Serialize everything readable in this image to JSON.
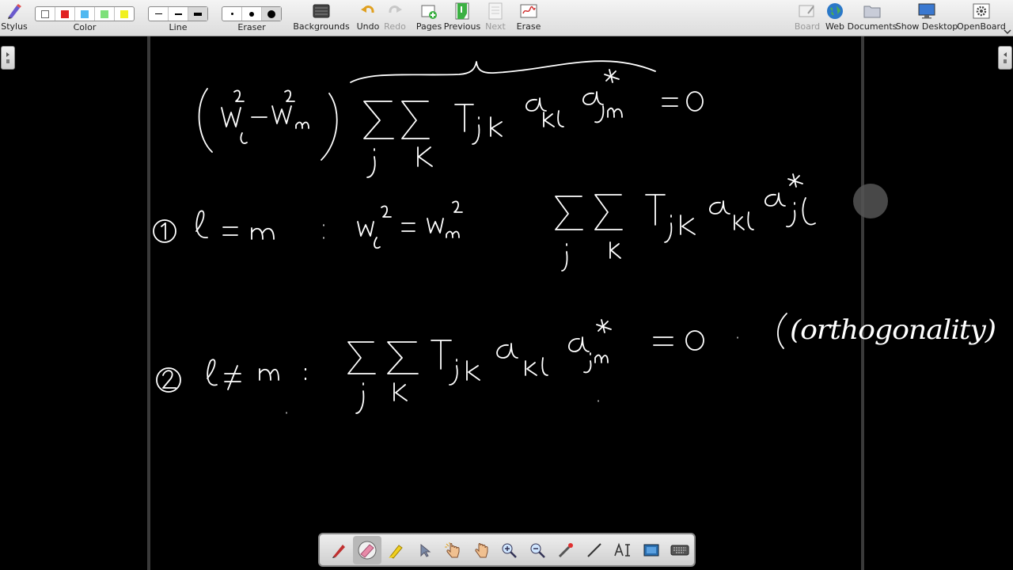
{
  "toolbar": {
    "stylus": "Stylus",
    "color": "Color",
    "line": "Line",
    "eraser": "Eraser",
    "backgrounds": "Backgrounds",
    "undo": "Undo",
    "redo": "Redo",
    "pages": "Pages",
    "previous": "Previous",
    "next": "Next",
    "erase": "Erase",
    "board": "Board",
    "web": "Web",
    "documents": "Documents",
    "show_desktop": "Show Desktop",
    "openboard": "OpenBoard"
  },
  "colors": {
    "swatches": [
      "#ffffff",
      "#e02020",
      "#4fb8f0",
      "#7ee07a",
      "#f0f020"
    ],
    "ink": "#ffffff",
    "background": "#000000"
  },
  "ink_text": {
    "orthogonality": "(orthogonality)"
  },
  "palette_tools": [
    "pen-icon",
    "eraser-icon",
    "marker-icon",
    "selector-icon",
    "interact-icon",
    "hand-icon",
    "zoom-in-icon",
    "zoom-out-icon",
    "laser-pointer-icon",
    "line-icon",
    "text-icon",
    "capture-icon",
    "keyboard-icon"
  ]
}
